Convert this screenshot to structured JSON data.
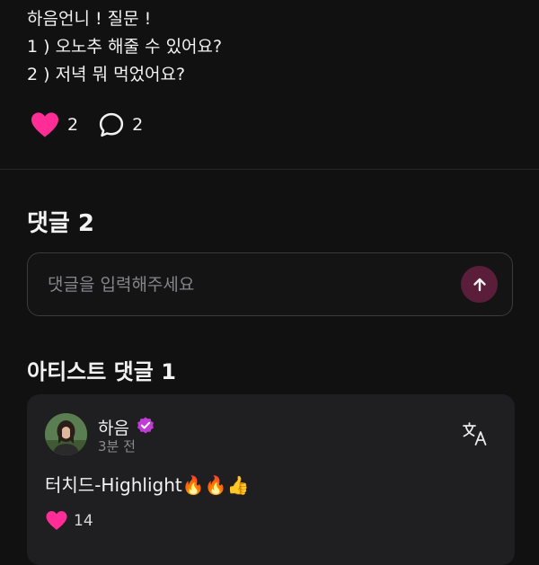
{
  "post": {
    "lines": [
      "하음언니 ! 질문 !",
      "1 ) 오노추 해줄 수 있어요?",
      "2 ) 저녁 뭐 먹었어요?"
    ],
    "like_count": "2",
    "comment_count": "2"
  },
  "comments": {
    "title": "댓글 2",
    "input_placeholder": "댓글을 입력해주세요"
  },
  "artist_comments": {
    "title": "아티스트 댓글 1",
    "items": [
      {
        "author": "하음",
        "time": "3분 전",
        "text": "터치드-Highlight🔥🔥👍",
        "like_count": "14"
      }
    ]
  },
  "colors": {
    "background": "#111112",
    "accent_pink": "#ff2d95",
    "verified_purple": "#c13bd8",
    "send_button": "#5a1d3a"
  },
  "icons": [
    "heart-icon",
    "comment-bubble-icon",
    "arrow-up-icon",
    "verified-badge-icon",
    "translate-icon"
  ]
}
